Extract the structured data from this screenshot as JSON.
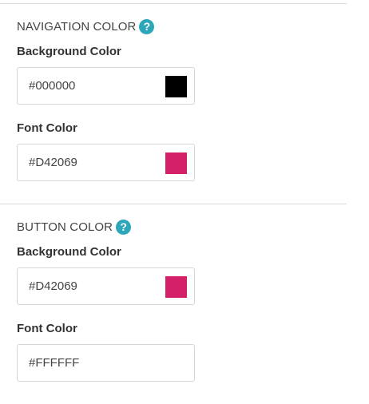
{
  "navigation": {
    "title": "NAVIGATION COLOR",
    "help_symbol": "?",
    "background": {
      "label": "Background Color",
      "value": "#000000",
      "swatch_color": "#000000"
    },
    "font": {
      "label": "Font Color",
      "value": "#D42069",
      "swatch_color": "#D42069"
    }
  },
  "button": {
    "title": "BUTTON COLOR",
    "help_symbol": "?",
    "background": {
      "label": "Background Color",
      "value": "#D42069",
      "swatch_color": "#D42069"
    },
    "font": {
      "label": "Font Color",
      "value": "#FFFFFF",
      "swatch_color": "#FFFFFF"
    }
  },
  "accent_color": "#2CA6B8",
  "icons": [
    "question-mark-icon"
  ]
}
